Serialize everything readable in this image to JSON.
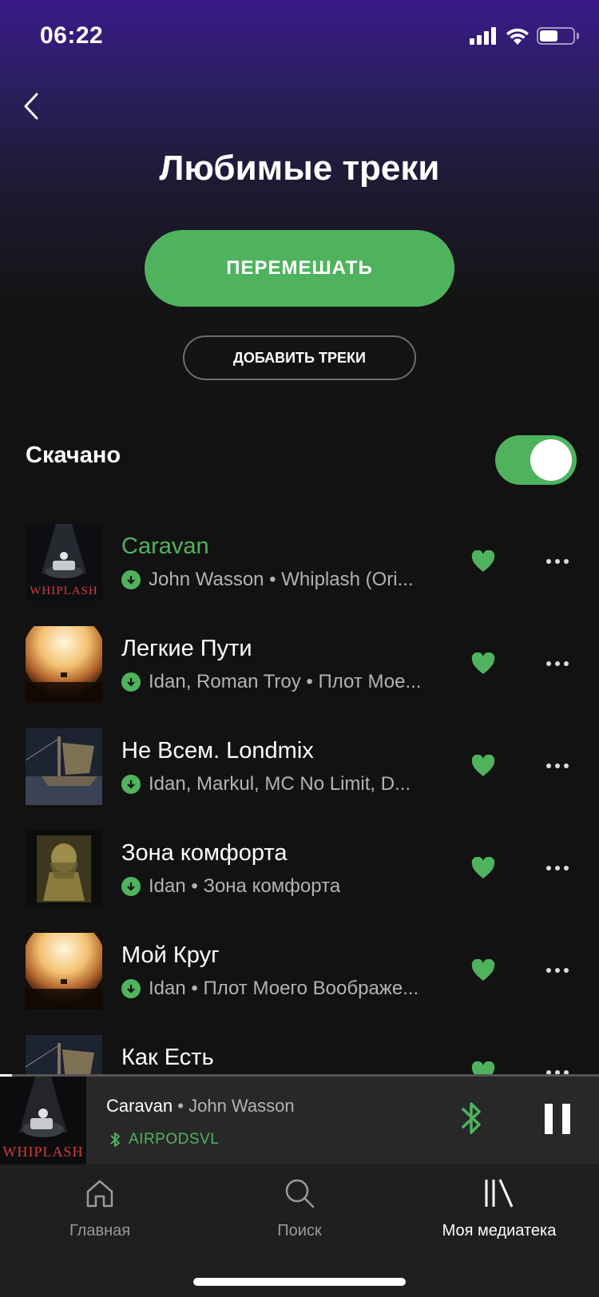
{
  "status_bar": {
    "time": "06:22"
  },
  "header": {
    "title": "Любимые треки"
  },
  "actions": {
    "shuffle_label": "ПЕРЕМЕШАТЬ",
    "add_label": "ДОБАВИТЬ ТРЕКИ"
  },
  "downloaded": {
    "label": "Скачано",
    "enabled": true
  },
  "tracks": [
    {
      "title": "Caravan",
      "subtitle": "John Wasson • Whiplash (Ori...",
      "playing": true,
      "cover": "whiplash-cover"
    },
    {
      "title": "Легкие Пути",
      "subtitle": "Idan, Roman Troy • Плот Мое...",
      "playing": false,
      "cover": "sun-cover"
    },
    {
      "title": "Не Всем. Londmix",
      "subtitle": "Idan, Markul, MC No Limit, D...",
      "playing": false,
      "cover": "ship-cover"
    },
    {
      "title": "Зона комфорта",
      "subtitle": "Idan • Зона комфорта",
      "playing": false,
      "cover": "figure-cover"
    },
    {
      "title": "Мой Круг",
      "subtitle": "Idan • Плот Моего Воображе...",
      "playing": false,
      "cover": "sun-cover"
    },
    {
      "title": "Как Есть",
      "subtitle": "",
      "playing": false,
      "cover": "ship-cover"
    }
  ],
  "now_playing": {
    "title": "Caravan",
    "separator": " • ",
    "artist": "John Wasson",
    "device": "AIRPODSVL",
    "cover_text": "WHIPLASH",
    "progress": 0.02
  },
  "covers": {
    "whiplash_text": "WHIPLASH"
  },
  "tabs": [
    {
      "label": "Главная",
      "icon": "home-icon",
      "active": false
    },
    {
      "label": "Поиск",
      "icon": "search-icon",
      "active": false
    },
    {
      "label": "Моя медиатека",
      "icon": "library-icon",
      "active": true
    }
  ],
  "colors": {
    "accent": "#4fb35e",
    "background": "#121212",
    "player": "#282828"
  }
}
